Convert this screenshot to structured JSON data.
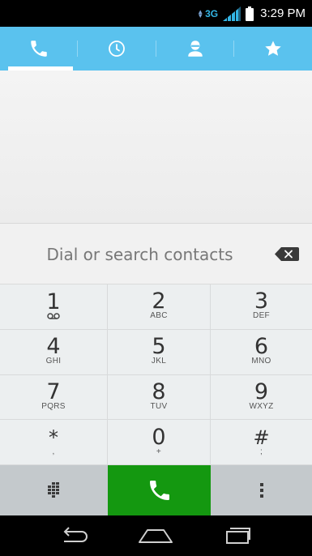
{
  "status_bar": {
    "network": "3G",
    "time": "3:29 PM"
  },
  "tabs": [
    {
      "icon": "phone-icon",
      "active": true
    },
    {
      "icon": "clock-icon",
      "active": false
    },
    {
      "icon": "contact-icon",
      "active": false
    },
    {
      "icon": "star-icon",
      "active": false
    }
  ],
  "search": {
    "placeholder": "Dial or search contacts"
  },
  "keypad": {
    "keys": [
      {
        "digit": "1",
        "letters": "voicemail"
      },
      {
        "digit": "2",
        "letters": "ABC"
      },
      {
        "digit": "3",
        "letters": "DEF"
      },
      {
        "digit": "4",
        "letters": "GHI"
      },
      {
        "digit": "5",
        "letters": "JKL"
      },
      {
        "digit": "6",
        "letters": "MNO"
      },
      {
        "digit": "7",
        "letters": "PQRS"
      },
      {
        "digit": "8",
        "letters": "TUV"
      },
      {
        "digit": "9",
        "letters": "WXYZ"
      },
      {
        "digit": "*",
        "letters": ","
      },
      {
        "digit": "0",
        "letters": "+"
      },
      {
        "digit": "#",
        "letters": ";"
      }
    ]
  },
  "actions": {
    "dialpad_icon": "dialpad-icon",
    "call_icon": "call-icon",
    "more_icon": "overflow-menu-icon"
  },
  "colors": {
    "tab_bar": "#5ac2ee",
    "call_button": "#149810",
    "keypad_bg": "#eceff0"
  }
}
